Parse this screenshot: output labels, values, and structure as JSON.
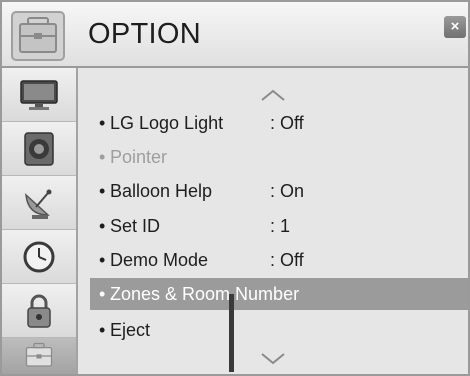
{
  "header": {
    "title": "OPTION",
    "close_label": "×",
    "icon": "option-toolbox-icon"
  },
  "sidebar": {
    "items": [
      {
        "name": "picture",
        "icon": "tv-monitor-icon",
        "active": false
      },
      {
        "name": "audio",
        "icon": "speaker-icon",
        "active": false
      },
      {
        "name": "channel",
        "icon": "satellite-dish-icon",
        "active": false
      },
      {
        "name": "time",
        "icon": "clock-icon",
        "active": false
      },
      {
        "name": "lock",
        "icon": "padlock-icon",
        "active": false
      },
      {
        "name": "option",
        "icon": "toolbox-icon",
        "active": true
      }
    ]
  },
  "menu": {
    "items": [
      {
        "label": "LG Logo Light",
        "value": ": Off",
        "state": "normal"
      },
      {
        "label": "Pointer",
        "value": "",
        "state": "disabled"
      },
      {
        "label": "Balloon Help",
        "value": ": On",
        "state": "normal"
      },
      {
        "label": "Set ID",
        "value": ": 1",
        "state": "normal"
      },
      {
        "label": "Demo Mode",
        "value": ": Off",
        "state": "normal"
      },
      {
        "label": "Zones & Room Number",
        "value": "",
        "state": "selected"
      },
      {
        "label": "Eject",
        "value": "",
        "state": "normal"
      }
    ],
    "bullet": "•"
  },
  "colors": {
    "selected_bg": "#9b9b9b",
    "disabled_text": "#9e9e9e",
    "text": "#1e1e1e"
  }
}
